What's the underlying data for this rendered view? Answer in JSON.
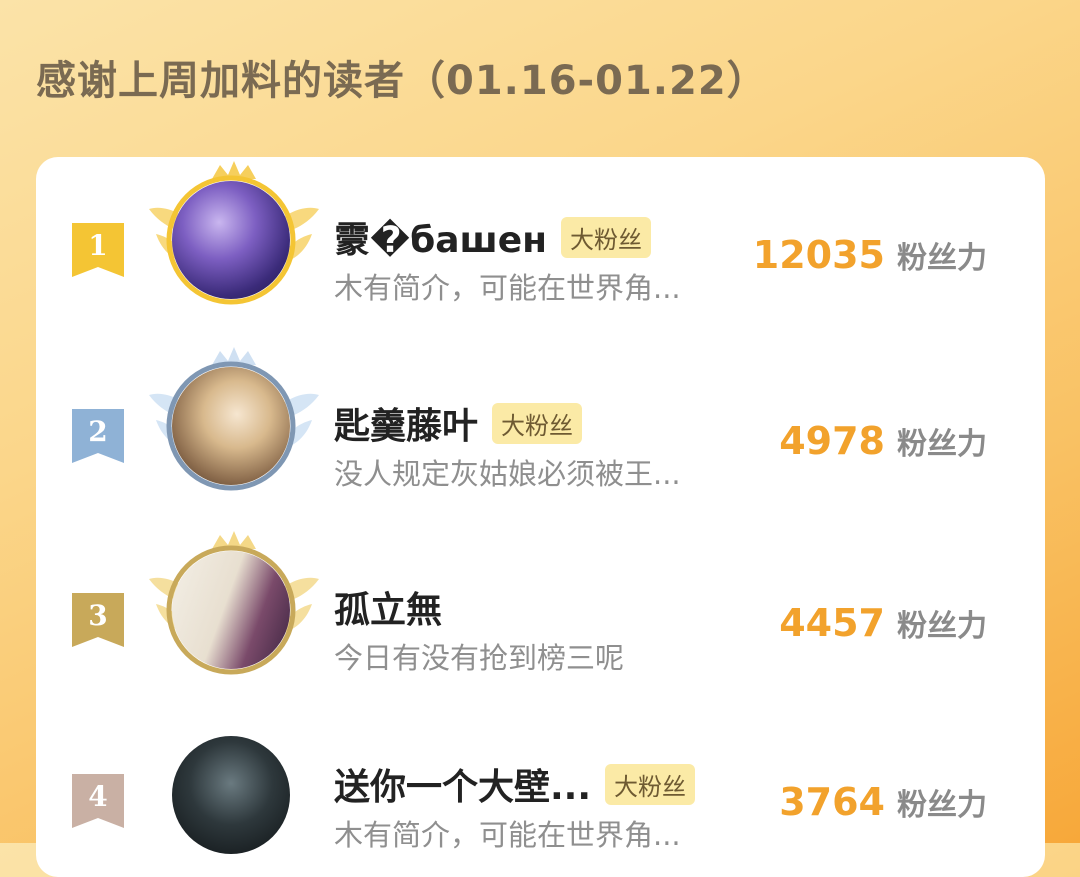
{
  "header": {
    "title": "感谢上周加料的读者（01.16-01.22）"
  },
  "colors": {
    "accent": "#f2a22c",
    "gold": "#f4c534",
    "silver": "#8fb2d6",
    "bronze": "#c8a95a",
    "fourth": "#c9b0a4"
  },
  "ranking": [
    {
      "rank": "1",
      "name": "霥�башен",
      "tag": "大粉丝",
      "bio": "木有简介，可能在世界角...",
      "score": "12035",
      "unit": "粉丝力",
      "avatar": "avatar-1"
    },
    {
      "rank": "2",
      "name": "匙羹藤叶",
      "tag": "大粉丝",
      "bio": "没人规定灰姑娘必须被王...",
      "score": "4978",
      "unit": "粉丝力",
      "avatar": "avatar-2"
    },
    {
      "rank": "3",
      "name": "孤立無",
      "tag": "",
      "bio": "今日有没有抢到榜三呢",
      "score": "4457",
      "unit": "粉丝力",
      "avatar": "avatar-3"
    },
    {
      "rank": "4",
      "name": "送你一个大壁...",
      "tag": "大粉丝",
      "bio": "木有简介，可能在世界角...",
      "score": "3764",
      "unit": "粉丝力",
      "avatar": "avatar-4"
    }
  ]
}
